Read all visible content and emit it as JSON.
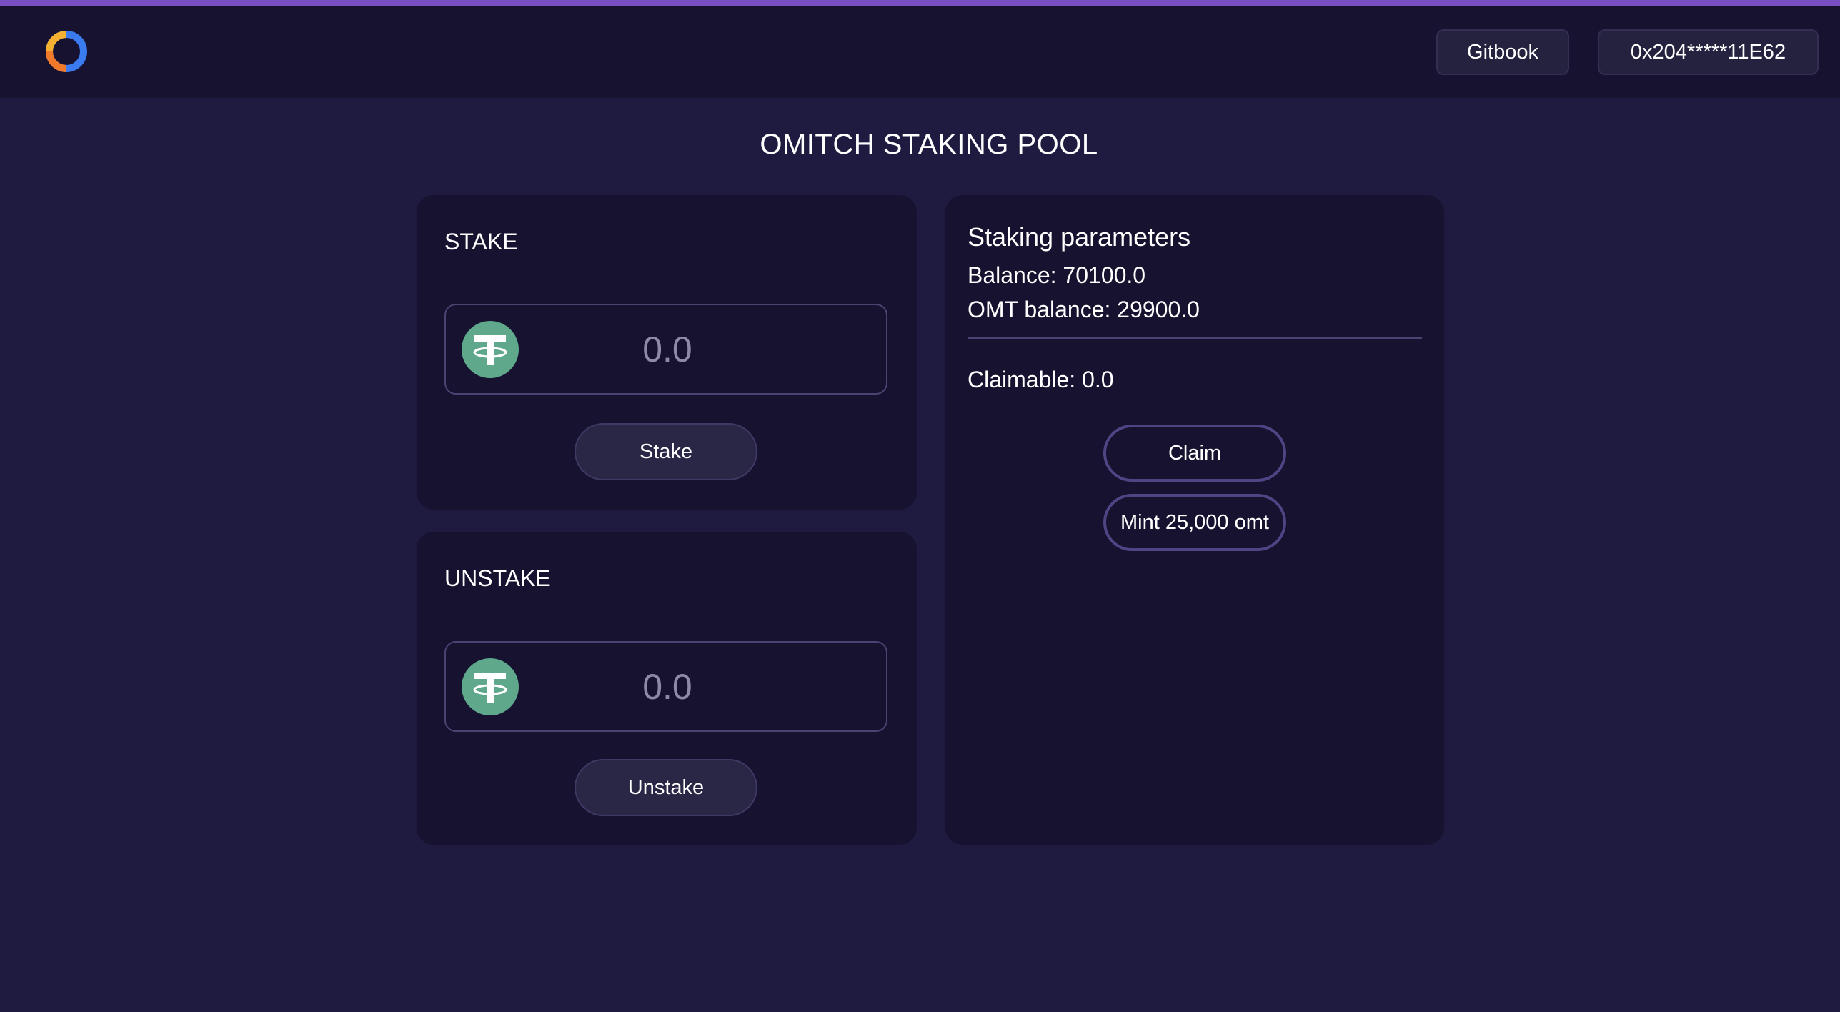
{
  "header": {
    "gitbook_label": "Gitbook",
    "wallet_label": "0x204*****11E62"
  },
  "page": {
    "title": "OMITCH STAKING POOL"
  },
  "stake": {
    "title": "STAKE",
    "placeholder": "0.0",
    "button_label": "Stake",
    "token_icon": "tether-icon"
  },
  "unstake": {
    "title": "UNSTAKE",
    "placeholder": "0.0",
    "button_label": "Unstake",
    "token_icon": "tether-icon"
  },
  "params": {
    "title": "Staking parameters",
    "balance": "Balance: 70100.0",
    "omt_balance": "OMT balance: 29900.0",
    "claimable": "Claimable: 0.0",
    "claim_label": "Claim",
    "mint_label": "Mint 25,000 omt"
  },
  "colors": {
    "background": "#1f1b40",
    "card": "#16122f",
    "accent": "#7a4fc4",
    "tether": "#5fa88c"
  }
}
